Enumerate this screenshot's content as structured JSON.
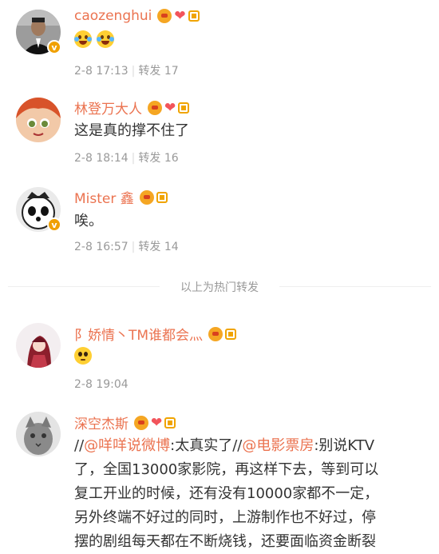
{
  "comments": [
    {
      "username": "caozenghui",
      "emoji_count": 2,
      "emoji_names": [
        "laugh-cry-emoji",
        "laugh-cry-emoji"
      ],
      "date": "2-8 17:13",
      "repost_label": "转发 17"
    },
    {
      "username": "林登万大人",
      "text": "这是真的撑不住了",
      "date": "2-8 18:14",
      "repost_label": "转发 16"
    },
    {
      "username": "Mister 鑫",
      "text": "唉。",
      "date": "2-8 16:57",
      "repost_label": "转发 14"
    },
    {
      "username": "阝娇情丶TM谁都会灬",
      "emoji_names": [
        "pitiful-emoji"
      ],
      "date": "2-8 19:04"
    },
    {
      "username": "深空杰斯",
      "text_lines": [
        {
          "pre": "//",
          "link1": "@咩咩说微博",
          "mid": ":太真实了//",
          "link2": "@电影票房",
          "post": ":别说KTV"
        },
        "了，全国13000家影院，再这样下去，等到可以",
        "复工开业的时候，还有没有10000家都不一定，",
        "另外终端不好过的同时，上游制作也不好过，停",
        "摆的剧组每天都在不断烧钱，还要面临资金断裂"
      ]
    }
  ],
  "divider_label": "以上为热门转发",
  "colors": {
    "name": "#eb7350",
    "meta": "#999999",
    "verified": "#f0a000"
  }
}
